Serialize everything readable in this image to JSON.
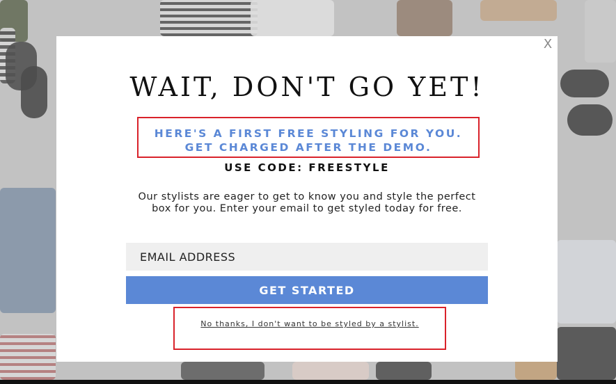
{
  "modal": {
    "close_label": "X",
    "headline": "WAIT, DON'T GO YET!",
    "promo_line1": "HERE'S A FIRST FREE STYLING FOR YOU.",
    "promo_line2": "GET CHARGED AFTER THE DEMO.",
    "code_text": "USE CODE: FREESTYLE",
    "description": "Our stylists are eager to get to know you and style the perfect box for you. Enter your email to get styled today for free.",
    "email_placeholder": "EMAIL ADDRESS",
    "cta_label": "GET STARTED",
    "decline_text": "No thanks, I don't want to be styled by a stylist."
  },
  "colors": {
    "accent_blue": "#5b88d6",
    "highlight_red": "#d9222a",
    "input_bg": "#efefef"
  }
}
